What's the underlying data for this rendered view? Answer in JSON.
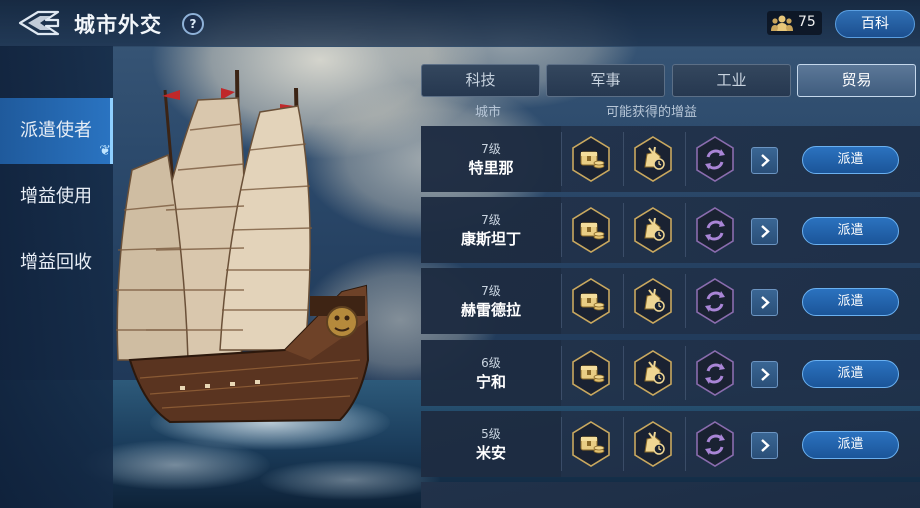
{
  "header": {
    "title": "城市外交",
    "help_glyph": "?",
    "resource_count": "75",
    "wiki_label": "百科"
  },
  "sidebar": {
    "items": [
      {
        "label": "派遣使者",
        "active": true
      },
      {
        "label": "增益使用",
        "active": false
      },
      {
        "label": "增益回收",
        "active": false
      }
    ]
  },
  "tabs": [
    {
      "label": "科技",
      "active": false
    },
    {
      "label": "军事",
      "active": false
    },
    {
      "label": "工业",
      "active": false
    },
    {
      "label": "贸易",
      "active": true
    }
  ],
  "columns": {
    "city": "城市",
    "buffs": "可能获得的增益"
  },
  "rows": [
    {
      "level": "7级",
      "city": "特里那",
      "action": "派遣"
    },
    {
      "level": "7级",
      "city": "康斯坦丁",
      "action": "派遣"
    },
    {
      "level": "7级",
      "city": "赫雷德拉",
      "action": "派遣"
    },
    {
      "level": "6级",
      "city": "宁和",
      "action": "派遣"
    },
    {
      "level": "5级",
      "city": "米安",
      "action": "派遣"
    }
  ],
  "buff_icons": [
    "treasure-chest-icon",
    "resource-bag-icon",
    "cycle-icon"
  ],
  "colors": {
    "accent": "#2a74c2",
    "gold": "#e8c77a",
    "purple": "#9c74c9"
  }
}
